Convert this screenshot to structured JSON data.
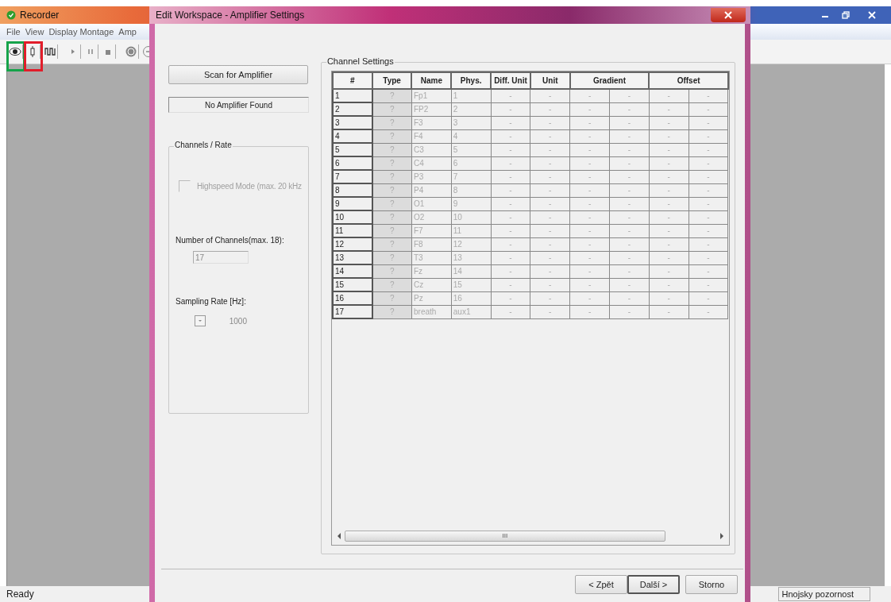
{
  "main_window": {
    "title": "Recorder",
    "menu": [
      "File",
      "View",
      "Display Montage",
      "Amp"
    ],
    "toolbar": [
      {
        "kind": "eye"
      },
      {
        "kind": "plug"
      },
      {
        "kind": "wave"
      },
      {
        "kind": "play"
      },
      {
        "kind": "pause"
      },
      {
        "kind": "stop"
      },
      {
        "kind": "s-circle"
      },
      {
        "kind": "minus-circle"
      }
    ],
    "highlights": [
      {
        "color": "#16a34a"
      },
      {
        "color": "#e11d2a"
      }
    ],
    "status_bar": {
      "left": "Ready",
      "right": "Hnojsky pozornost"
    }
  },
  "dialog": {
    "title": "Edit Workspace - Amplifier Settings",
    "scan_button": "Scan for Amplifier",
    "amplifier_status": "No Amplifier Found",
    "channels_rate": {
      "title": "Channels / Rate",
      "highspeed": {
        "label": "Highspeed Mode (max. 20 kHz",
        "checked": false,
        "disabled": true
      },
      "channels_label": "Number of Channels(max. 18):",
      "channels_field": {
        "value": "17",
        "disabled": true
      },
      "rate_label": "Sampling Rate [Hz]:",
      "rate_dropdown": {
        "value": "1000",
        "disabled": true
      }
    },
    "channel_settings": {
      "title": "Channel Settings",
      "columns": [
        "#",
        "Type",
        "Name",
        "Phys.",
        "Diff. Unit",
        "Unit",
        "Gradient",
        "Offset"
      ],
      "rows": [
        {
          "num": "1",
          "type": "?",
          "name": "Fp1",
          "phys": "1",
          "values": [
            "-",
            "-",
            "-",
            "-",
            "-",
            "-"
          ]
        },
        {
          "num": "2",
          "type": "?",
          "name": "FP2",
          "phys": "2",
          "values": [
            "-",
            "-",
            "-",
            "-",
            "-",
            "-"
          ]
        },
        {
          "num": "3",
          "type": "?",
          "name": "F3",
          "phys": "3",
          "values": [
            "-",
            "-",
            "-",
            "-",
            "-",
            "-"
          ]
        },
        {
          "num": "4",
          "type": "?",
          "name": "F4",
          "phys": "4",
          "values": [
            "-",
            "-",
            "-",
            "-",
            "-",
            "-"
          ]
        },
        {
          "num": "5",
          "type": "?",
          "name": "C3",
          "phys": "5",
          "values": [
            "-",
            "-",
            "-",
            "-",
            "-",
            "-"
          ]
        },
        {
          "num": "6",
          "type": "?",
          "name": "C4",
          "phys": "6",
          "values": [
            "-",
            "-",
            "-",
            "-",
            "-",
            "-"
          ]
        },
        {
          "num": "7",
          "type": "?",
          "name": "P3",
          "phys": "7",
          "values": [
            "-",
            "-",
            "-",
            "-",
            "-",
            "-"
          ]
        },
        {
          "num": "8",
          "type": "?",
          "name": "P4",
          "phys": "8",
          "values": [
            "-",
            "-",
            "-",
            "-",
            "-",
            "-"
          ]
        },
        {
          "num": "9",
          "type": "?",
          "name": "O1",
          "phys": "9",
          "values": [
            "-",
            "-",
            "-",
            "-",
            "-",
            "-"
          ]
        },
        {
          "num": "10",
          "type": "?",
          "name": "O2",
          "phys": "10",
          "values": [
            "-",
            "-",
            "-",
            "-",
            "-",
            "-"
          ]
        },
        {
          "num": "11",
          "type": "?",
          "name": "F7",
          "phys": "11",
          "values": [
            "-",
            "-",
            "-",
            "-",
            "-",
            "-"
          ]
        },
        {
          "num": "12",
          "type": "?",
          "name": "F8",
          "phys": "12",
          "values": [
            "-",
            "-",
            "-",
            "-",
            "-",
            "-"
          ]
        },
        {
          "num": "13",
          "type": "?",
          "name": "T3",
          "phys": "13",
          "values": [
            "-",
            "-",
            "-",
            "-",
            "-",
            "-"
          ]
        },
        {
          "num": "14",
          "type": "?",
          "name": "Fz",
          "phys": "14",
          "values": [
            "-",
            "-",
            "-",
            "-",
            "-",
            "-"
          ]
        },
        {
          "num": "15",
          "type": "?",
          "name": "Cz",
          "phys": "15",
          "values": [
            "-",
            "-",
            "-",
            "-",
            "-",
            "-"
          ]
        },
        {
          "num": "16",
          "type": "?",
          "name": "Pz",
          "phys": "16",
          "values": [
            "-",
            "-",
            "-",
            "-",
            "-",
            "-"
          ]
        },
        {
          "num": "17",
          "type": "?",
          "name": "breath",
          "phys": "aux1",
          "values": [
            "-",
            "-",
            "-",
            "-",
            "-",
            "-"
          ]
        }
      ],
      "scroll_grip": "III"
    },
    "buttons": [
      {
        "label": "< Zpět",
        "default": false
      },
      {
        "label": "Další >",
        "default": true
      },
      {
        "label": "Storno",
        "default": false
      }
    ]
  }
}
